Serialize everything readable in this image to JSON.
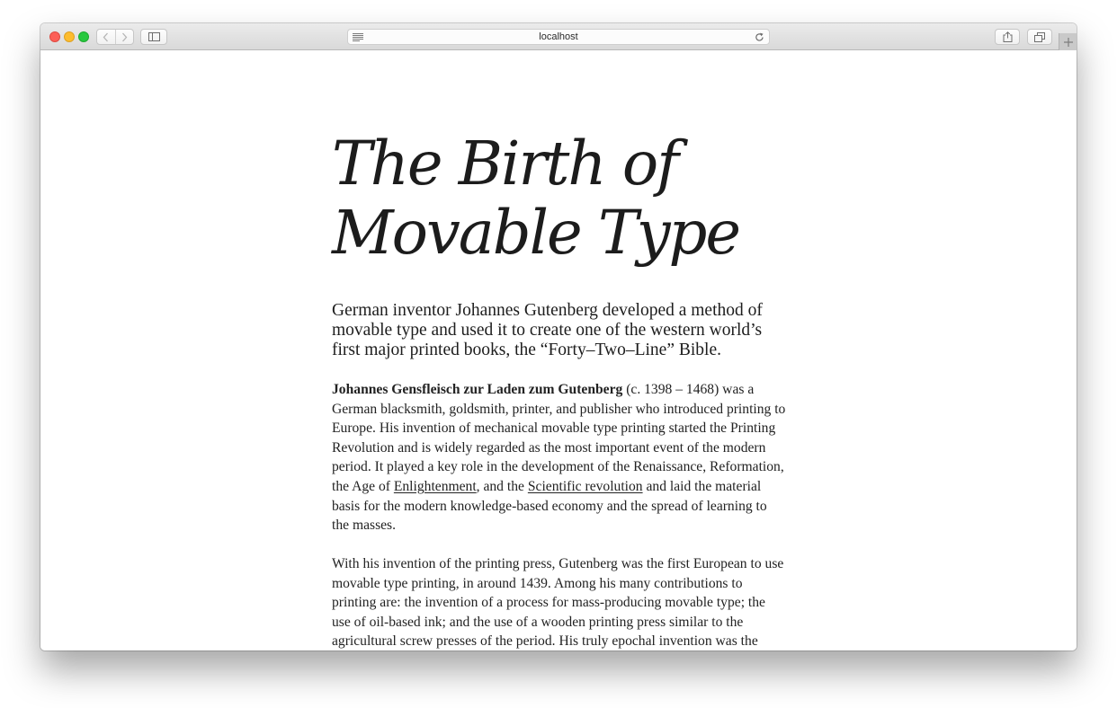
{
  "browser": {
    "url": "localhost"
  },
  "article": {
    "title_line1": "The Birth of",
    "title_line2": "Movable Type",
    "lead": "German inventor Johannes Gutenberg developed a method of movable type and used it to create one of the western world’s first major printed books, the “Forty–Two–Line” Bible.",
    "p1": {
      "name": "Johannes Gensfleisch zur Laden zum Gutenberg",
      "text_a": " (c. 1398 – 1468) was a German blacksmith, goldsmith, printer, and publisher who introduced printing to Europe. His invention of mechanical movable type printing started the Printing Revolution and is widely regarded as the most important event of the modern period. It played a key role in the development of the Renaissance, Reformation, the Age of ",
      "link_enlightenment": "Enlightenment",
      "text_b": ", and the ",
      "link_scientific": "Scientific revolution",
      "text_c": " and laid the material basis for the modern knowledge-based economy and the spread of learning to the masses."
    },
    "p2": "With his invention of the printing press, Gutenberg was the first European to use movable type printing, in around 1439. Among his many contributions to printing are: the invention of a process for mass-producing movable type; the use of oil-based ink; and the use of a wooden printing press similar to the agricultural screw presses of the period. His truly epochal invention was the"
  },
  "icons": {
    "close": "close-traffic-light",
    "minimize": "minimize-traffic-light",
    "maximize": "maximize-traffic-light",
    "back": "chevron-left-icon",
    "forward": "chevron-right-icon",
    "sidebar": "sidebar-icon",
    "reader": "reader-icon",
    "reload": "reload-icon",
    "share": "share-icon",
    "tabs": "tabs-icon",
    "new_tab": "plus-icon"
  },
  "colors": {
    "close": "#fc5f57",
    "minimize": "#fdbc2e",
    "maximize": "#28c83f",
    "text": "#1d1d1d"
  }
}
